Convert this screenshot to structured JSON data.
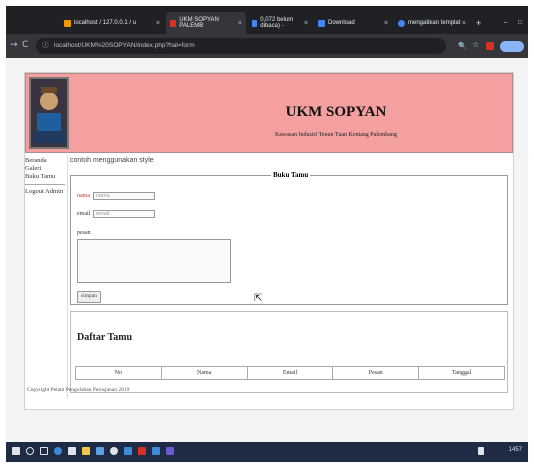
{
  "browser": {
    "tabs": [
      {
        "label": "localhost / 127.0.0.1 / u",
        "color": "#f29900"
      },
      {
        "label": "UKM SOPYAN PALEMB",
        "color": "#d93025"
      },
      {
        "label": "0,072 belum dibaca) -",
        "color": "#4285f4"
      },
      {
        "label": "Download",
        "color": "#4285f4"
      },
      {
        "label": "mengatikan templat",
        "color": "#4285f4"
      }
    ],
    "url": "localhost/UKM%20SOPYAN/index.php?hal=form"
  },
  "site": {
    "title": "UKM SOPYAN",
    "subtitle": "Kawasan Industri Tenun Tuan Kentang Palembang",
    "header_color": "#f4a0a0",
    "menu": [
      "Beranda",
      "Galeri",
      "Buku Tamu",
      "Logout Admin"
    ],
    "note": "contoh menggunakan style",
    "guestbook": {
      "legend": "Buku Tamu",
      "name_label": "nama",
      "name_placeholder": "nama",
      "email_label": "email",
      "email_placeholder": "email",
      "message_label": "pesan",
      "submit_label": "simpan"
    },
    "list": {
      "title": "Daftar Tamu",
      "columns": [
        "No",
        "Nama",
        "Email",
        "Pesan",
        "Tanggal"
      ]
    },
    "footer": "Copyright Pelatn Pengolahan Perusjanan 2019"
  },
  "taskbar": {
    "clock": "1457"
  }
}
